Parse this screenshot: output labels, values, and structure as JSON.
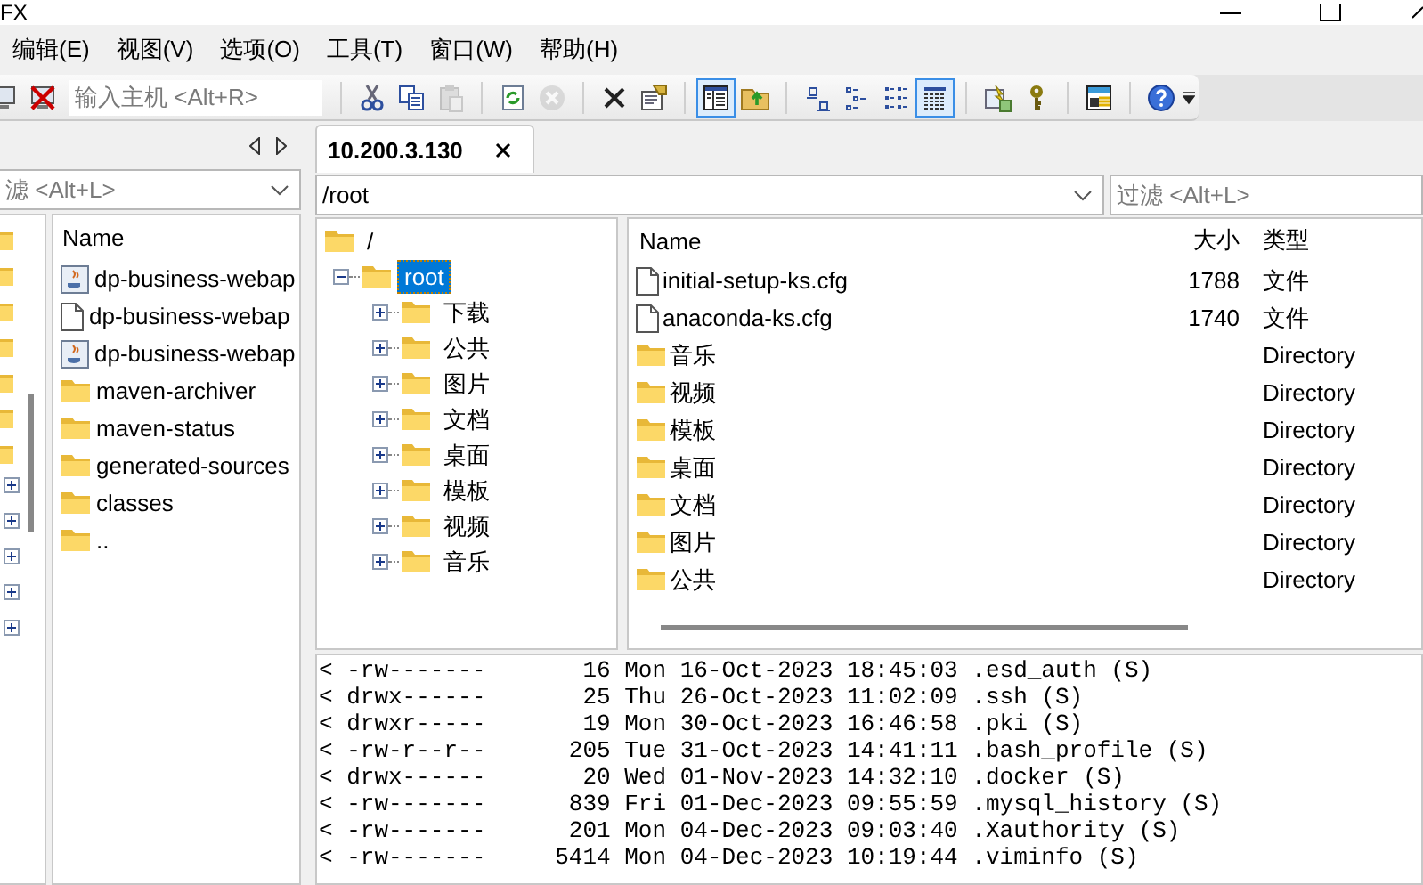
{
  "window": {
    "title": "FX"
  },
  "menu": [
    {
      "label": "编辑(E)"
    },
    {
      "label": "视图(V)"
    },
    {
      "label": "选项(O)"
    },
    {
      "label": "工具(T)"
    },
    {
      "label": "窗口(W)"
    },
    {
      "label": "帮助(H)"
    }
  ],
  "toolbar": [
    {
      "kind": "connect",
      "selected": false,
      "disabled": false
    },
    {
      "kind": "disconnect",
      "selected": false,
      "disabled": false
    },
    {
      "kind": "host-field",
      "placeholder": "输入主机 <Alt+R>"
    },
    {
      "kind": "separator"
    },
    {
      "kind": "cut",
      "selected": false,
      "disabled": false
    },
    {
      "kind": "copy",
      "selected": false,
      "disabled": false
    },
    {
      "kind": "paste",
      "selected": false,
      "disabled": true
    },
    {
      "kind": "separator"
    },
    {
      "kind": "refresh",
      "selected": false,
      "disabled": false
    },
    {
      "kind": "stop",
      "selected": false,
      "disabled": true
    },
    {
      "kind": "separator"
    },
    {
      "kind": "delete",
      "selected": false,
      "disabled": false
    },
    {
      "kind": "properties",
      "selected": false,
      "disabled": false
    },
    {
      "kind": "separator"
    },
    {
      "kind": "panel",
      "selected": true,
      "disabled": false
    },
    {
      "kind": "up-folder",
      "selected": false,
      "disabled": false
    },
    {
      "kind": "separator"
    },
    {
      "kind": "small-icons",
      "selected": false,
      "disabled": false
    },
    {
      "kind": "list-view",
      "selected": false,
      "disabled": false
    },
    {
      "kind": "tree-view",
      "selected": false,
      "disabled": false
    },
    {
      "kind": "details-view",
      "selected": true,
      "disabled": false
    },
    {
      "kind": "separator"
    },
    {
      "kind": "sync",
      "selected": false,
      "disabled": false
    },
    {
      "kind": "key",
      "selected": false,
      "disabled": false
    },
    {
      "kind": "separator"
    },
    {
      "kind": "keygen",
      "selected": false,
      "disabled": false
    },
    {
      "kind": "separator"
    },
    {
      "kind": "help",
      "selected": false,
      "disabled": false
    }
  ],
  "local_pane": {
    "filter": {
      "placeholder": "滤 <Alt+L>"
    },
    "columns": [
      {
        "label": "Name"
      }
    ],
    "rows": [
      {
        "kind": "java",
        "name": "dp-business-webap"
      },
      {
        "kind": "file",
        "name": "dp-business-webap"
      },
      {
        "kind": "java",
        "name": "dp-business-webap"
      },
      {
        "kind": "folder",
        "name": "maven-archiver"
      },
      {
        "kind": "folder",
        "name": "maven-status"
      },
      {
        "kind": "folder",
        "name": "generated-sources"
      },
      {
        "kind": "folder",
        "name": "classes"
      },
      {
        "kind": "folder",
        "name": ".."
      }
    ]
  },
  "session_tabs": [
    {
      "label": "10.200.3.130",
      "selected": true
    }
  ],
  "path_field": {
    "value": "/root"
  },
  "filter": {
    "placeholder": "过滤 <Alt+L>"
  },
  "tree": [
    {
      "name": "/",
      "selected": false,
      "children": [
        {
          "name": "root",
          "selected": true,
          "expanded": true,
          "children": [
            {
              "name": "下载",
              "selected": false,
              "expanded": false
            },
            {
              "name": "公共",
              "selected": false,
              "expanded": false
            },
            {
              "name": "图片",
              "selected": false,
              "expanded": false
            },
            {
              "name": "文档",
              "selected": false,
              "expanded": false
            },
            {
              "name": "桌面",
              "selected": false,
              "expanded": false
            },
            {
              "name": "模板",
              "selected": false,
              "expanded": false
            },
            {
              "name": "视频",
              "selected": false,
              "expanded": false
            },
            {
              "name": "音乐",
              "selected": false,
              "expanded": false
            }
          ]
        }
      ]
    }
  ],
  "file_list": {
    "columns": [
      {
        "label": "Name"
      },
      {
        "label": "大小"
      },
      {
        "label": "类型"
      }
    ],
    "rows": [
      {
        "kind": "file",
        "name": "initial-setup-ks.cfg",
        "size": "1788",
        "type": "文件"
      },
      {
        "kind": "file",
        "name": "anaconda-ks.cfg",
        "size": "1740",
        "type": "文件"
      },
      {
        "kind": "folder",
        "name": "音乐",
        "type": "Directory"
      },
      {
        "kind": "folder",
        "name": "视频",
        "type": "Directory"
      },
      {
        "kind": "folder",
        "name": "模板",
        "type": "Directory"
      },
      {
        "kind": "folder",
        "name": "桌面",
        "type": "Directory"
      },
      {
        "kind": "folder",
        "name": "文档",
        "type": "Directory"
      },
      {
        "kind": "folder",
        "name": "图片",
        "type": "Directory"
      },
      {
        "kind": "folder",
        "name": "公共",
        "type": "Directory"
      }
    ]
  },
  "log": [
    "< -rw-------       16 Mon 16-Oct-2023 18:45:03 .esd_auth (S)",
    "< drwx------       25 Thu 26-Oct-2023 11:02:09 .ssh (S)",
    "< drwxr-----       19 Mon 30-Oct-2023 16:46:58 .pki (S)",
    "< -rw-r--r--      205 Tue 31-Oct-2023 14:41:11 .bash_profile (S)",
    "< drwx------       20 Wed 01-Nov-2023 14:32:10 .docker (S)",
    "< -rw-------      839 Fri 01-Dec-2023 09:55:59 .mysql_history (S)",
    "< -rw-------      201 Mon 04-Dec-2023 09:03:40 .Xauthority (S)",
    "< -rw-------     5414 Mon 04-Dec-2023 10:19:44 .viminfo (S)"
  ]
}
